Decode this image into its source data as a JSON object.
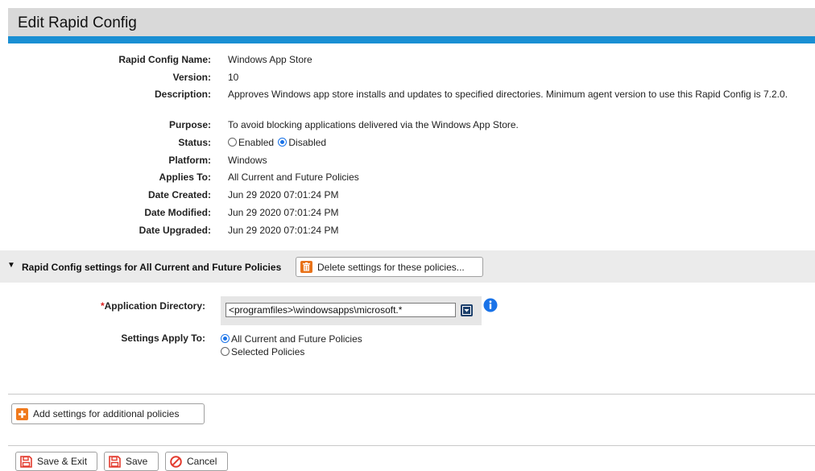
{
  "page": {
    "title": "Edit Rapid Config"
  },
  "details": {
    "name_label": "Rapid Config Name:",
    "name": "Windows App Store",
    "version_label": "Version:",
    "version": "10",
    "description_label": "Description:",
    "description": "Approves Windows app store installs and updates to specified directories. Minimum  agent version to use this Rapid Config is 7.2.0.",
    "purpose_label": "Purpose:",
    "purpose": "To avoid blocking applications delivered via the Windows App Store.",
    "status_label": "Status:",
    "status_enabled": "Enabled",
    "status_disabled": "Disabled",
    "platform_label": "Platform:",
    "platform": "Windows",
    "applies_label": "Applies To:",
    "applies": "All Current and Future Policies",
    "created_label": "Date Created:",
    "created": "Jun 29 2020 07:01:24 PM",
    "modified_label": "Date Modified:",
    "modified": "Jun 29 2020 07:01:24 PM",
    "upgraded_label": "Date Upgraded:",
    "upgraded": "Jun 29 2020 07:01:24 PM"
  },
  "section": {
    "title": "Rapid Config settings for All Current and Future Policies",
    "delete_button": "Delete settings for these policies..."
  },
  "settings": {
    "required_mark": "*",
    "appdir_label": "Application Directory:",
    "appdir_value": "<programfiles>\\windowsapps\\microsoft.*",
    "apply_label": "Settings Apply To:",
    "apply_all": "All Current and Future Policies",
    "apply_selected": "Selected Policies"
  },
  "actions": {
    "add_settings": "Add settings for additional policies",
    "save_exit": "Save & Exit",
    "save": "Save",
    "cancel": "Cancel"
  },
  "colors": {
    "accent": "#1a8fd3",
    "header_bg": "#d9d9d9",
    "delete_orange": "#e8731a",
    "add_orange": "#f07a1e",
    "cancel_red": "#e33b2e",
    "info_blue": "#1a73e8",
    "required_red": "#d22"
  }
}
